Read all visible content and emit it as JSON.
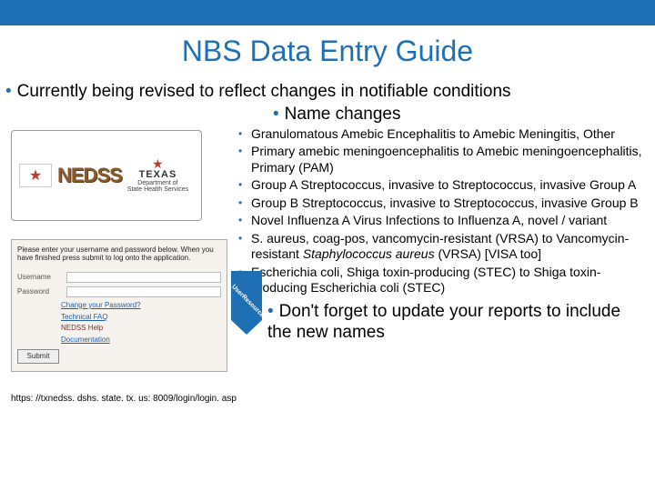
{
  "title": "NBS Data Entry Guide",
  "level1": "Currently being revised to reflect changes in notifiable conditions",
  "level2": "Name changes",
  "name_changes": [
    "Granulomatous Amebic Encephalitis to Amebic Meningitis, Other",
    "Primary amebic meningoencephalitis to Amebic meningoencephalitis, Primary (PAM)",
    "Group A Streptococcus, invasive to Streptococcus, invasive Group A",
    "Group B Streptococcus, invasive to Streptococcus, invasive Group B",
    "Novel Influenza A Virus Infections to Influenza A, novel / variant",
    "S. aureus, coag-pos, vancomycin-resistant (VRSA) to Vancomycin-resistant <i>Staphylococcus aureus</i> (VRSA) [VISA too]",
    "Escherichia coli, Shiga toxin-producing (STEC) to Shiga toxin-producing Escherichia coli (STEC)"
  ],
  "logo": {
    "nedss": "NEDSS",
    "texas": "TEXAS",
    "dept1": "Department of",
    "dept2": "State Health Services"
  },
  "login": {
    "prompt": "Please enter your username and password below. When you have finished press submit to log onto the application.",
    "username_label": "Username",
    "password_label": "Password",
    "change_pw": "Change your Password?",
    "faq": "Technical FAQ",
    "help": "NEDSS Help",
    "docs": "Documentation",
    "submit": "Submit"
  },
  "url": "https: //txnedss. dshs. state. tx. us: 8009/login/login. asp",
  "pennant": "UserResources",
  "closing": "Don't forget to update your reports to include the new names"
}
